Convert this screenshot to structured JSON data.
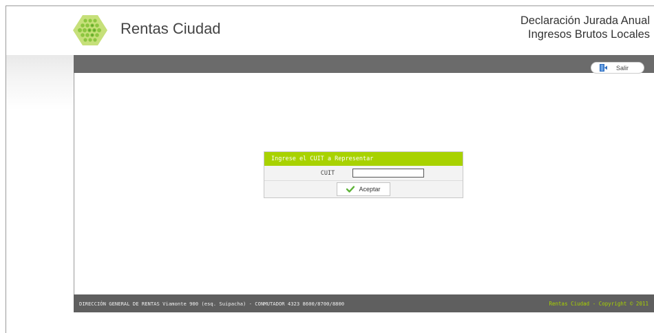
{
  "header": {
    "brand": "Rentas Ciudad",
    "title_line1": "Declaración Jurada Anual",
    "title_line2": "Ingresos Brutos Locales"
  },
  "topbar": {
    "exit_label": "Salir"
  },
  "cuit_form": {
    "heading": "Ingrese el CUIT a Representar",
    "label": "CUIT",
    "value": "",
    "accept_label": "Aceptar"
  },
  "footer": {
    "address": "DIRECCIÓN GENERAL DE RENTAS Viamonte 900 (esq. Suipacha) - CONMUTADOR 4323 8600/8700/8800",
    "copyright": "Rentas Ciudad - Copyright © 2011"
  },
  "colors": {
    "accent_green": "#a8d200",
    "bar_gray": "#6b6b6b",
    "footer_gray": "#5f5f5f"
  },
  "icons": {
    "logo": "rentas-ciudad-logo",
    "exit": "exit-door-icon",
    "accept": "checkmark-icon"
  }
}
